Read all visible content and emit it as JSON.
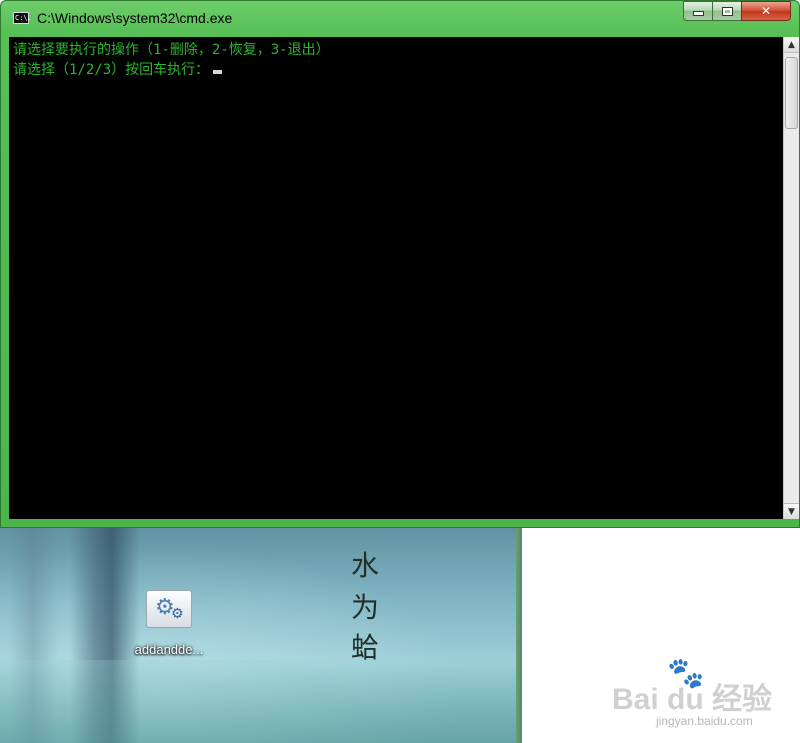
{
  "window": {
    "title": "C:\\Windows\\system32\\cmd.exe",
    "icon": "console-app-icon",
    "icon_text": "C:\\.",
    "buttons": {
      "minimize": "minimize-icon",
      "maximize": "maximize-icon",
      "close": "✕"
    },
    "frame_color": "#4cb54c"
  },
  "console": {
    "background": "#000000",
    "text_color": "#2bb52b",
    "lines": [
      "请选择要执行的操作（1-删除，2-恢复，3-退出）",
      "请选择（1/2/3）按回车执行："
    ]
  },
  "desktop": {
    "icon_label": "addandde...",
    "wallpaper_text": [
      "水",
      "为",
      "蛤"
    ]
  },
  "watermark": {
    "logo": "Bai du 经验",
    "site": "jingyan.baidu.com"
  }
}
